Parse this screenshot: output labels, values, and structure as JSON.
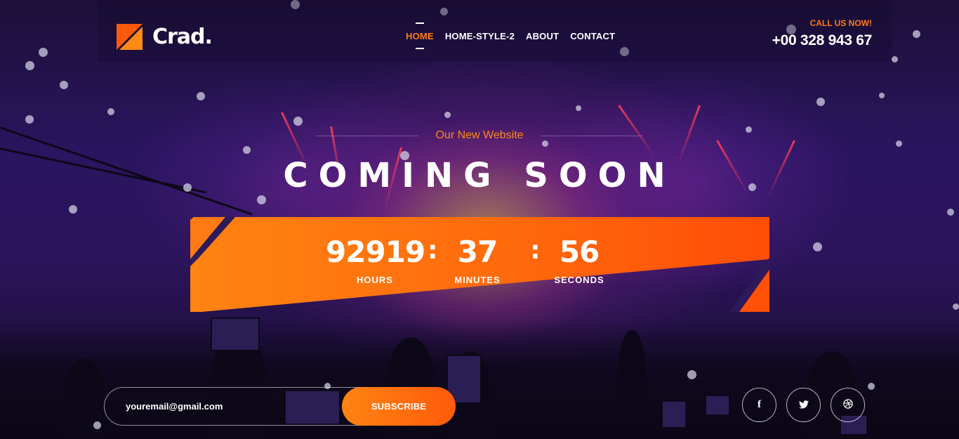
{
  "brand": {
    "name": "Crad.",
    "accent": "#ff7a18"
  },
  "nav": {
    "items": [
      {
        "label": "HOME",
        "active": true
      },
      {
        "label": "HOME-STYLE-2",
        "active": false
      },
      {
        "label": "ABOUT",
        "active": false
      },
      {
        "label": "CONTACT",
        "active": false
      }
    ]
  },
  "contact": {
    "label": "CALL US NOW!",
    "phone": "+00 328 943 67"
  },
  "hero": {
    "eyebrow": "Our New Website",
    "title": "COMING SOON"
  },
  "countdown": {
    "hours": {
      "value": "92919",
      "label": "HOURS"
    },
    "minutes": {
      "value": "37",
      "label": "MINUTES"
    },
    "seconds": {
      "value": "56",
      "label": "SECONDS"
    },
    "separator": ":"
  },
  "subscribe": {
    "placeholder": "youremail@gmail.com",
    "button_label": "SUBSCRIBE"
  },
  "social": [
    {
      "icon": "facebook-icon",
      "glyph": "f"
    },
    {
      "icon": "twitter-icon",
      "glyph": "🐦"
    },
    {
      "icon": "dribbble-icon",
      "glyph": "◎"
    }
  ]
}
